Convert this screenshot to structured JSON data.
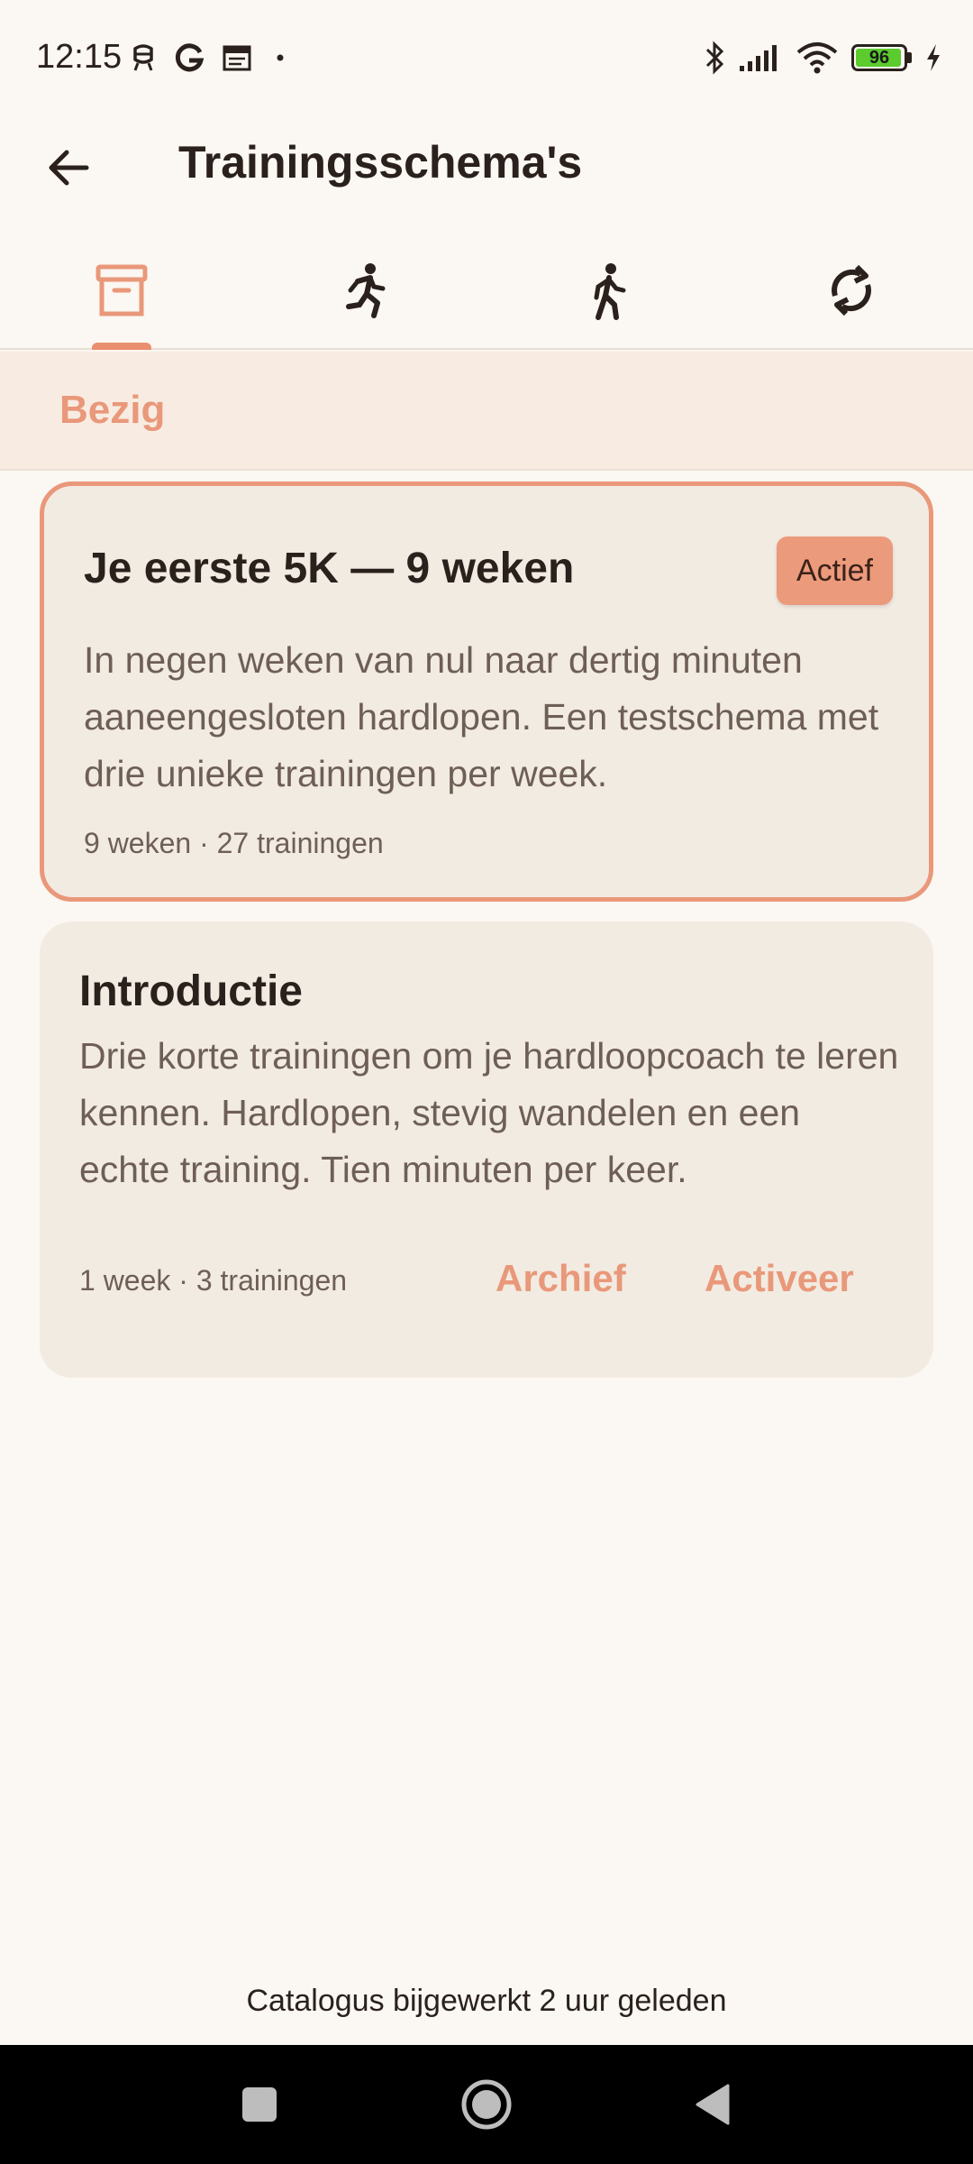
{
  "status_bar": {
    "time": "12:15",
    "battery_level": "96",
    "battery_fraction": 0.96,
    "battery_color": "#5BCB2E",
    "left_icons": [
      "notification-icon",
      "google-icon",
      "calendar-icon",
      "dot-icon"
    ],
    "right_icons": [
      "bluetooth-icon",
      "signal-icon",
      "wifi-icon",
      "battery-icon",
      "charging-icon"
    ]
  },
  "appbar": {
    "title": "Trainingsschema's",
    "back_icon": "arrow-left-icon"
  },
  "tabs": [
    {
      "icon": "archive-icon",
      "selected": true
    },
    {
      "icon": "running-icon",
      "selected": false
    },
    {
      "icon": "walking-icon",
      "selected": false
    },
    {
      "icon": "sync-icon",
      "selected": false
    }
  ],
  "section": {
    "title": "Bezig"
  },
  "plans": [
    {
      "title": "Je eerste 5K — 9 weken",
      "badge": "Actief",
      "description": "In negen weken van nul naar dertig minuten aaneengesloten hardlopen. Een testschema met drie unieke trainingen per week.",
      "meta": "9 weken · 27 trainingen",
      "active": true
    },
    {
      "title": "Introductie",
      "description": "Drie korte trainingen om je hardloopcoach te leren kennen. Hardlopen, stevig wandelen en een echte training. Tien minuten per keer.",
      "meta": "1 week · 3 trainingen",
      "archive_label": "Archief",
      "activate_label": "Activeer",
      "active": false
    }
  ],
  "footer": {
    "catalog_status": "Catalogus bijgewerkt 2 uur geleden"
  },
  "colors": {
    "accent": "#E9987A",
    "background": "#FBF7F2",
    "card": "#F2EBE2",
    "text": "#2A211C"
  }
}
